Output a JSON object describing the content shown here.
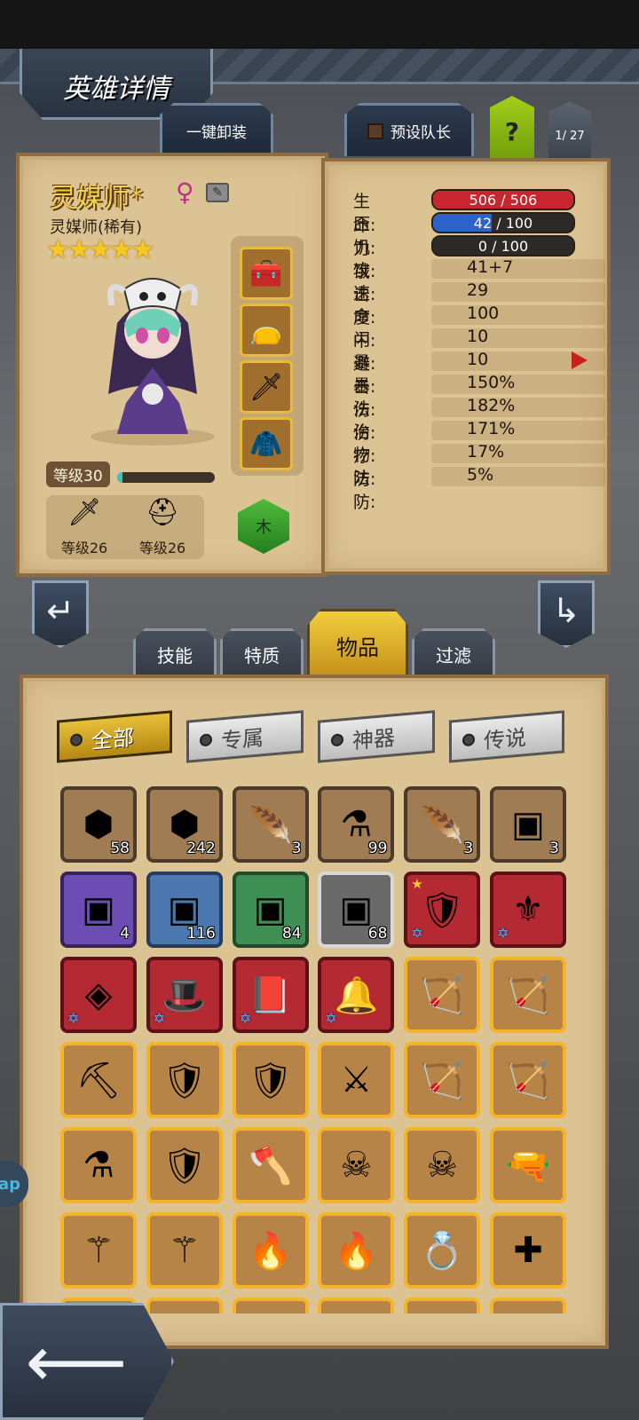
{
  "header": {
    "title": "英雄详情",
    "unequip_all": "一键卸装",
    "preset_leader": "预设队长",
    "help": "?",
    "page": "1/ 27"
  },
  "hero": {
    "name": "灵媒师*",
    "gender_symbol": "♀",
    "class_rarity": "灵媒师(稀有)",
    "stars": "★★★★★",
    "level": "等级30",
    "xp_fraction": 0.05,
    "element": "木",
    "slots": [
      "treasure-chest-icon",
      "potion-pouch-icon",
      "sword-icon",
      "hood-icon"
    ],
    "equipment": [
      {
        "icon": "sword-icon",
        "level": "等级26"
      },
      {
        "icon": "helmet-icon",
        "level": "等级26"
      }
    ]
  },
  "stats": {
    "hp_label": "生命:",
    "hp_value": "506 / 506",
    "hp_fraction": 1.0,
    "stress_label": "压力:",
    "stress_value": "42 / 100",
    "stress_fraction": 0.42,
    "hunger_label": "饥饿:",
    "hunger_value": "0 / 100",
    "hunger_fraction": 0.0,
    "rows": [
      {
        "label": "攻击:",
        "value": "41+7"
      },
      {
        "label": "速度:",
        "value": "29"
      },
      {
        "label": "命中:",
        "value": "100"
      },
      {
        "label": "闪避:",
        "value": "10"
      },
      {
        "label": "暴击:",
        "value": "10"
      },
      {
        "label": "暴伤:",
        "value": "150%"
      },
      {
        "label": "法伤:",
        "value": "182%"
      },
      {
        "label": "治疗:",
        "value": "171%"
      },
      {
        "label": "物防:",
        "value": "17%"
      },
      {
        "label": "法防:",
        "value": "5%"
      }
    ]
  },
  "tabs": {
    "skills": "技能",
    "traits": "特质",
    "items": "物品",
    "filter": "过滤"
  },
  "filters": {
    "all": "全部",
    "exclusive": "专属",
    "artifact": "神器",
    "legendary": "传说"
  },
  "side_tab": "ap",
  "inventory": [
    [
      {
        "icon": "⬢",
        "name": "orange-rune-icon",
        "count": "58",
        "rarity": "plain"
      },
      {
        "icon": "⬢",
        "name": "teal-rune-icon",
        "count": "242",
        "rarity": "plain"
      },
      {
        "icon": "🪶",
        "name": "golden-feather-icon",
        "count": "3",
        "rarity": "plain"
      },
      {
        "icon": "⚗",
        "name": "teal-potion-icon",
        "count": "99",
        "rarity": "plain"
      },
      {
        "icon": "🪶",
        "name": "white-feather-icon",
        "count": "3",
        "rarity": "plain"
      },
      {
        "icon": "▣",
        "name": "treasure-chest-icon",
        "count": "3",
        "rarity": "plain"
      }
    ],
    [
      {
        "icon": "▣",
        "name": "purple-chest-icon",
        "count": "4",
        "rarity": "purple"
      },
      {
        "icon": "▣",
        "name": "blue-chest-icon",
        "count": "116",
        "rarity": "blue"
      },
      {
        "icon": "▣",
        "name": "green-chest-icon",
        "count": "84",
        "rarity": "green"
      },
      {
        "icon": "▣",
        "name": "gray-chest-icon",
        "count": "68",
        "rarity": "gray"
      },
      {
        "icon": "🛡",
        "name": "red-armor-icon",
        "count": "",
        "rarity": "red"
      },
      {
        "icon": "⚜",
        "name": "winged-mace-icon",
        "count": "",
        "rarity": "red"
      }
    ],
    [
      {
        "icon": "◈",
        "name": "amulet-icon",
        "count": "",
        "rarity": "red"
      },
      {
        "icon": "🎩",
        "name": "witch-hat-icon",
        "count": "",
        "rarity": "red"
      },
      {
        "icon": "📕",
        "name": "spellbook-icon",
        "count": "",
        "rarity": "red"
      },
      {
        "icon": "🔔",
        "name": "bell-charm-icon",
        "count": "",
        "rarity": "red"
      },
      {
        "icon": "🏹",
        "name": "crossbow-icon",
        "count": "",
        "rarity": "gold"
      },
      {
        "icon": "🏹",
        "name": "crossbow-icon",
        "count": "",
        "rarity": "gold"
      }
    ],
    [
      {
        "icon": "⛏",
        "name": "pickaxe-icon",
        "count": "",
        "rarity": "gold"
      },
      {
        "icon": "🛡",
        "name": "shield-icon",
        "count": "",
        "rarity": "gold"
      },
      {
        "icon": "🛡",
        "name": "shield-icon",
        "count": "",
        "rarity": "gold"
      },
      {
        "icon": "⚔",
        "name": "crossed-swords-icon",
        "count": "",
        "rarity": "gold"
      },
      {
        "icon": "🏹",
        "name": "bow-icon",
        "count": "",
        "rarity": "gold"
      },
      {
        "icon": "🏹",
        "name": "dark-bow-icon",
        "count": "",
        "rarity": "gold"
      }
    ],
    [
      {
        "icon": "⚗",
        "name": "green-potion-icon",
        "count": "",
        "rarity": "gold"
      },
      {
        "icon": "🛡",
        "name": "chest-armor-icon",
        "count": "",
        "rarity": "gold"
      },
      {
        "icon": "🪓",
        "name": "axe-icon",
        "count": "",
        "rarity": "gold"
      },
      {
        "icon": "☠",
        "name": "skull-cape-icon",
        "count": "",
        "rarity": "gold"
      },
      {
        "icon": "☠",
        "name": "skull-cape-icon",
        "count": "",
        "rarity": "gold"
      },
      {
        "icon": "🔫",
        "name": "rifle-icon",
        "count": "",
        "rarity": "gold"
      }
    ],
    [
      {
        "icon": "⚚",
        "name": "blue-staff-icon",
        "count": "",
        "rarity": "gold"
      },
      {
        "icon": "⚚",
        "name": "blue-staff-icon",
        "count": "",
        "rarity": "gold"
      },
      {
        "icon": "🔥",
        "name": "flame-staff-icon",
        "count": "",
        "rarity": "gold"
      },
      {
        "icon": "🔥",
        "name": "flame-staff-icon",
        "count": "",
        "rarity": "gold"
      },
      {
        "icon": "💍",
        "name": "ruby-ring-icon",
        "count": "",
        "rarity": "gold"
      },
      {
        "icon": "✚",
        "name": "medkit-icon",
        "count": "",
        "rarity": "gold"
      }
    ],
    [
      {
        "icon": "",
        "name": "item-slot",
        "count": "",
        "rarity": "gold"
      },
      {
        "icon": "",
        "name": "item-slot",
        "count": "",
        "rarity": "gold"
      },
      {
        "icon": "",
        "name": "item-slot",
        "count": "",
        "rarity": "gold"
      },
      {
        "icon": "",
        "name": "item-slot",
        "count": "",
        "rarity": "gold"
      },
      {
        "icon": "",
        "name": "item-slot",
        "count": "",
        "rarity": "gold"
      },
      {
        "icon": "",
        "name": "item-slot",
        "count": "",
        "rarity": "gold"
      }
    ]
  ],
  "colors": {
    "hp": "#c8262e",
    "stress": "#2d63c8",
    "accent_gold": "#f2cf4d"
  }
}
